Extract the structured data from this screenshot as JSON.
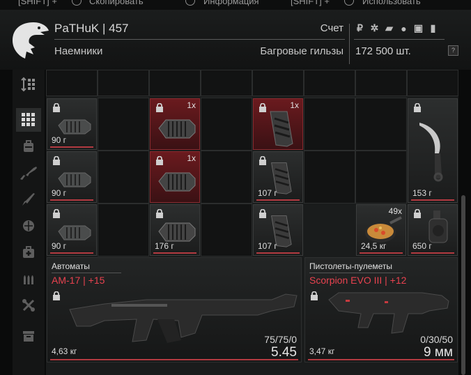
{
  "topbar": {
    "left_hint": "[SHIFT] +",
    "copy_label": "Скопировать",
    "info_label": "Информация",
    "right_hint": "[SHIFT] +",
    "use_label": "Использовать"
  },
  "player": {
    "name_level": "PaTHuK | 457",
    "faction": "Наемники"
  },
  "account": {
    "title": "Счет",
    "currency_name": "Багровые гильзы",
    "amount": "172 500 шт.",
    "help": "?",
    "currency_icons": [
      "ruble-icon",
      "gear-icon",
      "cartridge-icon",
      "coin-icon",
      "stamp-icon",
      "card-icon"
    ]
  },
  "sidebar": {
    "items": [
      "sort-icon",
      "grid-icon",
      "backpack-icon",
      "rifle-icon",
      "knife-icon",
      "grenade-icon",
      "medkit-icon",
      "ammo-icon",
      "tools-icon",
      "box-icon"
    ]
  },
  "items": [
    {
      "weight": "90 г",
      "count": "",
      "kind": "muzzle",
      "red": false
    },
    {
      "weight": "",
      "count": "1x",
      "kind": "muzzle",
      "red": true
    },
    {
      "weight": "",
      "count": "1x",
      "kind": "grip",
      "red": true
    },
    {
      "weight": "153 г",
      "count": "",
      "kind": "knife",
      "red": false
    },
    {
      "weight": "90 г",
      "count": "",
      "kind": "muzzle",
      "red": false
    },
    {
      "weight": "",
      "count": "1x",
      "kind": "muzzle",
      "red": true
    },
    {
      "weight": "107 г",
      "count": "",
      "kind": "grip",
      "red": false
    },
    {
      "weight": "90 г",
      "count": "",
      "kind": "muzzle",
      "red": false
    },
    {
      "weight": "176 г",
      "count": "",
      "kind": "muzzle",
      "red": false
    },
    {
      "weight": "107 г",
      "count": "",
      "kind": "grip",
      "red": false
    },
    {
      "weight": "24,5 кг",
      "count": "49x",
      "kind": "food",
      "red": false
    },
    {
      "weight": "650 г",
      "count": "",
      "kind": "magazine",
      "red": false
    }
  ],
  "weapons": [
    {
      "category": "Автоматы",
      "name": "АМ-17 | +15",
      "weight": "4,63 кг",
      "ammo": "75/75/0",
      "caliber": "5.45"
    },
    {
      "category": "Пистолеты-пулеметы",
      "name": "Scorpion EVO III | +12",
      "weight": "3,47 кг",
      "ammo": "0/30/50",
      "caliber": "9 мм"
    }
  ]
}
